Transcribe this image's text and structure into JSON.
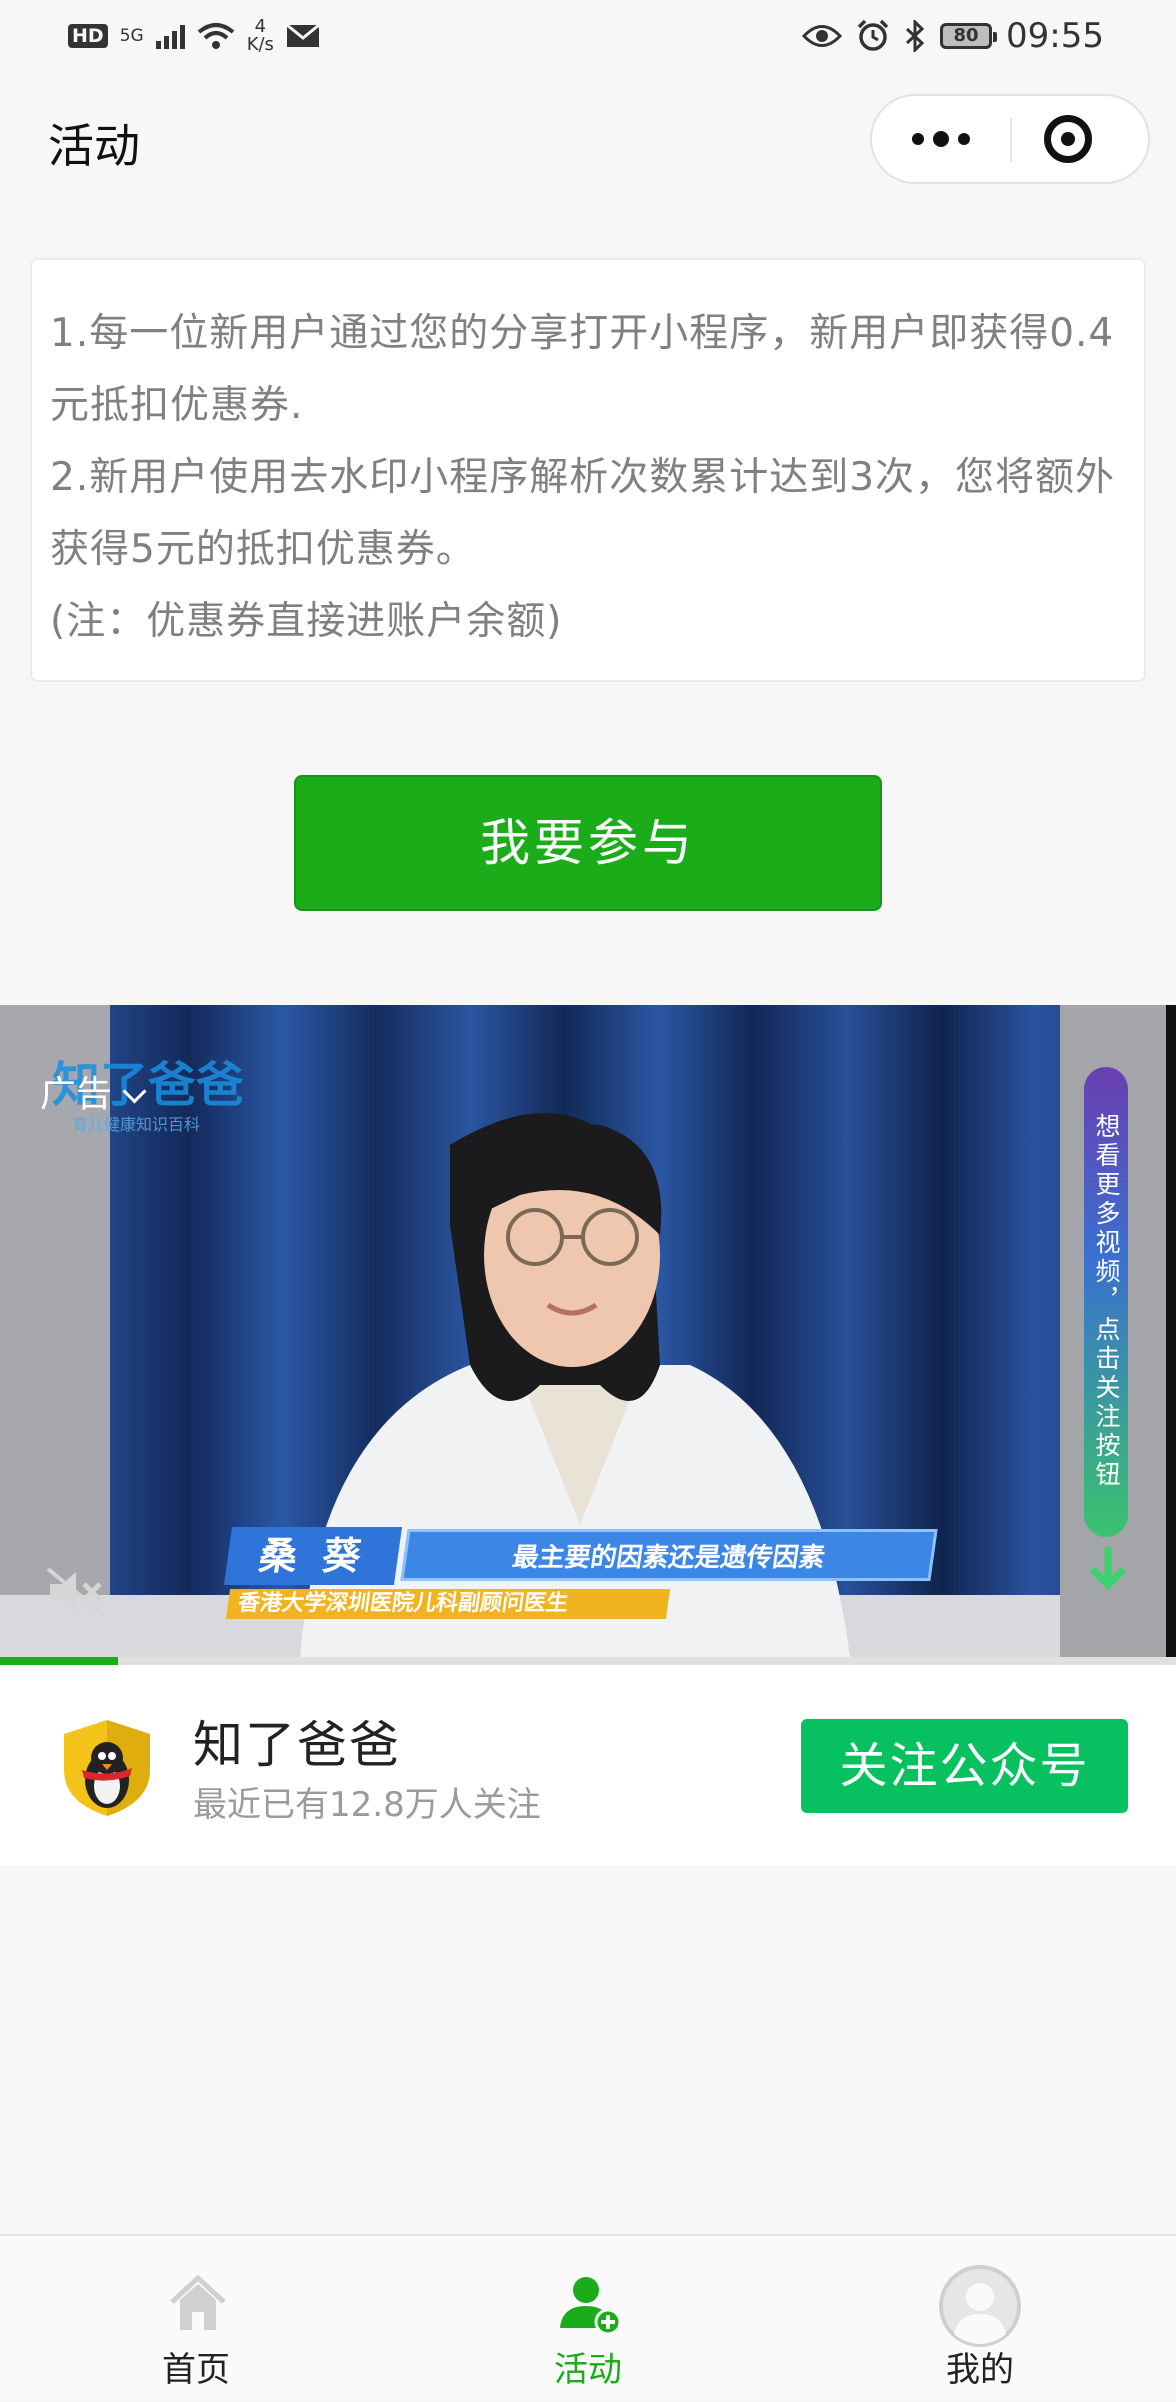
{
  "status_bar": {
    "hd": "HD",
    "network": "5G",
    "speed_value": "4",
    "speed_unit": "K/s",
    "battery": "80",
    "time": "09:55",
    "icons": [
      "signal-icon",
      "wifi-icon",
      "mail-icon",
      "eye-icon",
      "alarm-icon",
      "bluetooth-icon",
      "battery-icon"
    ]
  },
  "header": {
    "title": "活动",
    "menu_icon": "more-icon",
    "close_icon": "target-icon"
  },
  "rules": {
    "lines": [
      "1.每一位新用户通过您的分享打开小程序，新用户即获得0.4元抵扣优惠券.",
      "2.新用户使用去水印小程序解析次数累计达到3次，您将额外获得5元的抵扣优惠券。",
      "(注：优惠券直接进账户余额)"
    ]
  },
  "join_button": {
    "label": "我要参与"
  },
  "video_ad": {
    "ad_label": "广告",
    "watermark_brand": "知了爸爸",
    "watermark_sub": "育儿健康知识百科",
    "side_banner": "想看更多视频，点击关注按钮",
    "caption_name": "桑 葵",
    "caption_quote": "最主要的因素还是遗传因素",
    "caption_title": "香港大学深圳医院儿科副顾问医生",
    "progress": 0.1,
    "colors": {
      "progress": "#1aad19"
    }
  },
  "account": {
    "name": "知了爸爸",
    "followers": "最近已有12.8万人关注",
    "follow_button": "关注公众号"
  },
  "tabs": [
    {
      "label": "首页",
      "icon": "home-icon",
      "active": false
    },
    {
      "label": "活动",
      "icon": "user-add-icon",
      "active": true
    },
    {
      "label": "我的",
      "icon": "profile-icon",
      "active": false
    }
  ],
  "theme": {
    "accent": "#1aad19",
    "follow": "#07c160",
    "inactive_icon": "#d0d0d0"
  }
}
